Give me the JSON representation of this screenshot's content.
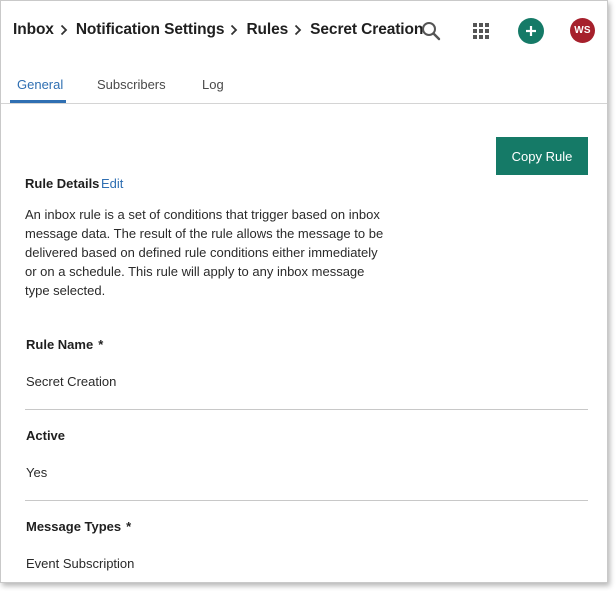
{
  "header": {
    "breadcrumb": [
      "Inbox",
      "Notification Settings",
      "Rules",
      "Secret Creation"
    ],
    "icons": [
      "search-icon",
      "apps-grid-icon",
      "add-icon"
    ],
    "avatar_initials": "WS",
    "colors": {
      "add_button": "#157a67",
      "avatar": "#a6202c"
    }
  },
  "tabs": {
    "items": [
      "General",
      "Subscribers",
      "Log"
    ],
    "active": "General",
    "accent": "#2f6fb2"
  },
  "actions": {
    "copy_rule_label": "Copy Rule",
    "color": "#157a67"
  },
  "rule_details": {
    "title": "Rule Details",
    "edit_label": "Edit",
    "description_lines": [
      "An inbox rule is a set of conditions that trigger based on inbox",
      "message data. The result of the rule allows the message to be",
      "delivered based on defined rule conditions either immediately",
      "or on a schedule. This rule will apply to any inbox message",
      "type selected."
    ]
  },
  "fields": [
    {
      "label": "Rule Name",
      "required": "*",
      "value": "Secret Creation"
    },
    {
      "label": "Active",
      "required": "",
      "value": "Yes"
    },
    {
      "label": "Message Types",
      "required": "*",
      "value": "Event Subscription"
    }
  ]
}
